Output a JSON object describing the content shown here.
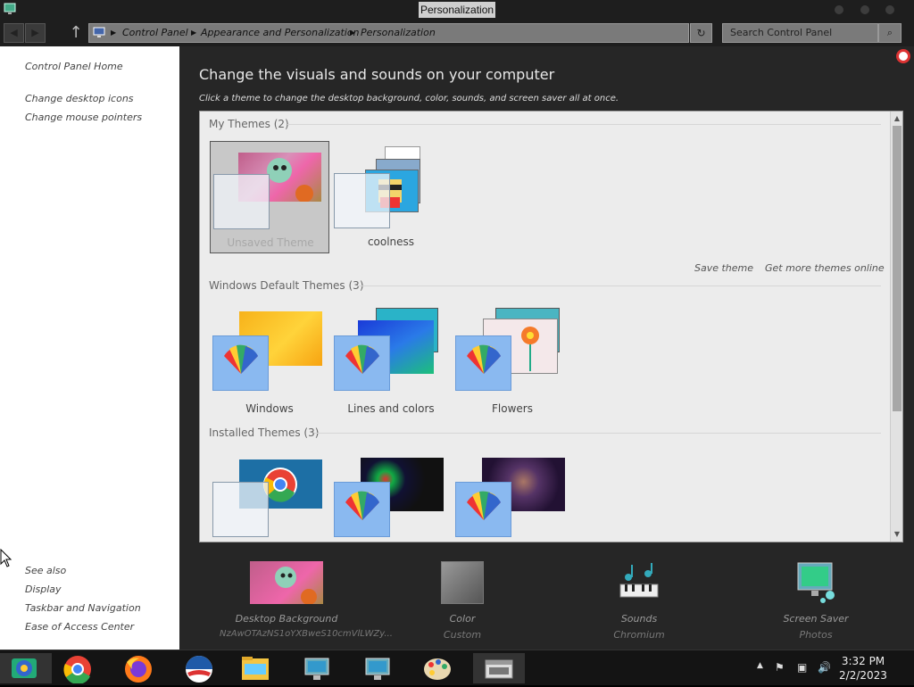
{
  "window": {
    "title": "Personalization"
  },
  "address": {
    "crumbs": [
      "Control Panel",
      "Appearance and Personalization",
      "Personalization"
    ],
    "search_placeholder": "Search Control Panel"
  },
  "sidebar": {
    "home": "Control Panel Home",
    "links": [
      "Change desktop icons",
      "Change mouse pointers"
    ],
    "see_also_title": "See also",
    "see_also": [
      "Display",
      "Taskbar and Navigation",
      "Ease of Access Center"
    ]
  },
  "main": {
    "heading": "Change the visuals and sounds on your computer",
    "subtext": "Click a theme to change the desktop background, color, sounds, and screen saver all at once.",
    "sections": {
      "my": "My Themes (2)",
      "default": "Windows Default Themes (3)",
      "installed": "Installed Themes (3)"
    },
    "my_themes": [
      {
        "label": "Unsaved Theme",
        "selected": true
      },
      {
        "label": "coolness"
      }
    ],
    "default_themes": [
      {
        "label": "Windows"
      },
      {
        "label": "Lines and colors"
      },
      {
        "label": "Flowers"
      }
    ],
    "installed_themes": [
      {
        "label": ""
      },
      {
        "label": ""
      },
      {
        "label": ""
      }
    ],
    "save_theme": "Save theme",
    "get_more": "Get more themes online"
  },
  "bottom": [
    {
      "title": "Desktop Background",
      "sub": "NzAwOTAzNS1oYXBweS10cmVlLWZy..."
    },
    {
      "title": "Color",
      "sub": "Custom"
    },
    {
      "title": "Sounds",
      "sub": "Chromium"
    },
    {
      "title": "Screen Saver",
      "sub": "Photos"
    }
  ],
  "taskbar": {
    "time": "3:32 PM",
    "date": "2/2/2023",
    "apps": [
      "control-panel",
      "chrome",
      "firefox",
      "obama",
      "file-explorer",
      "remote-desktop",
      "remote-desktop-2",
      "paint",
      "taskbar-settings"
    ]
  }
}
